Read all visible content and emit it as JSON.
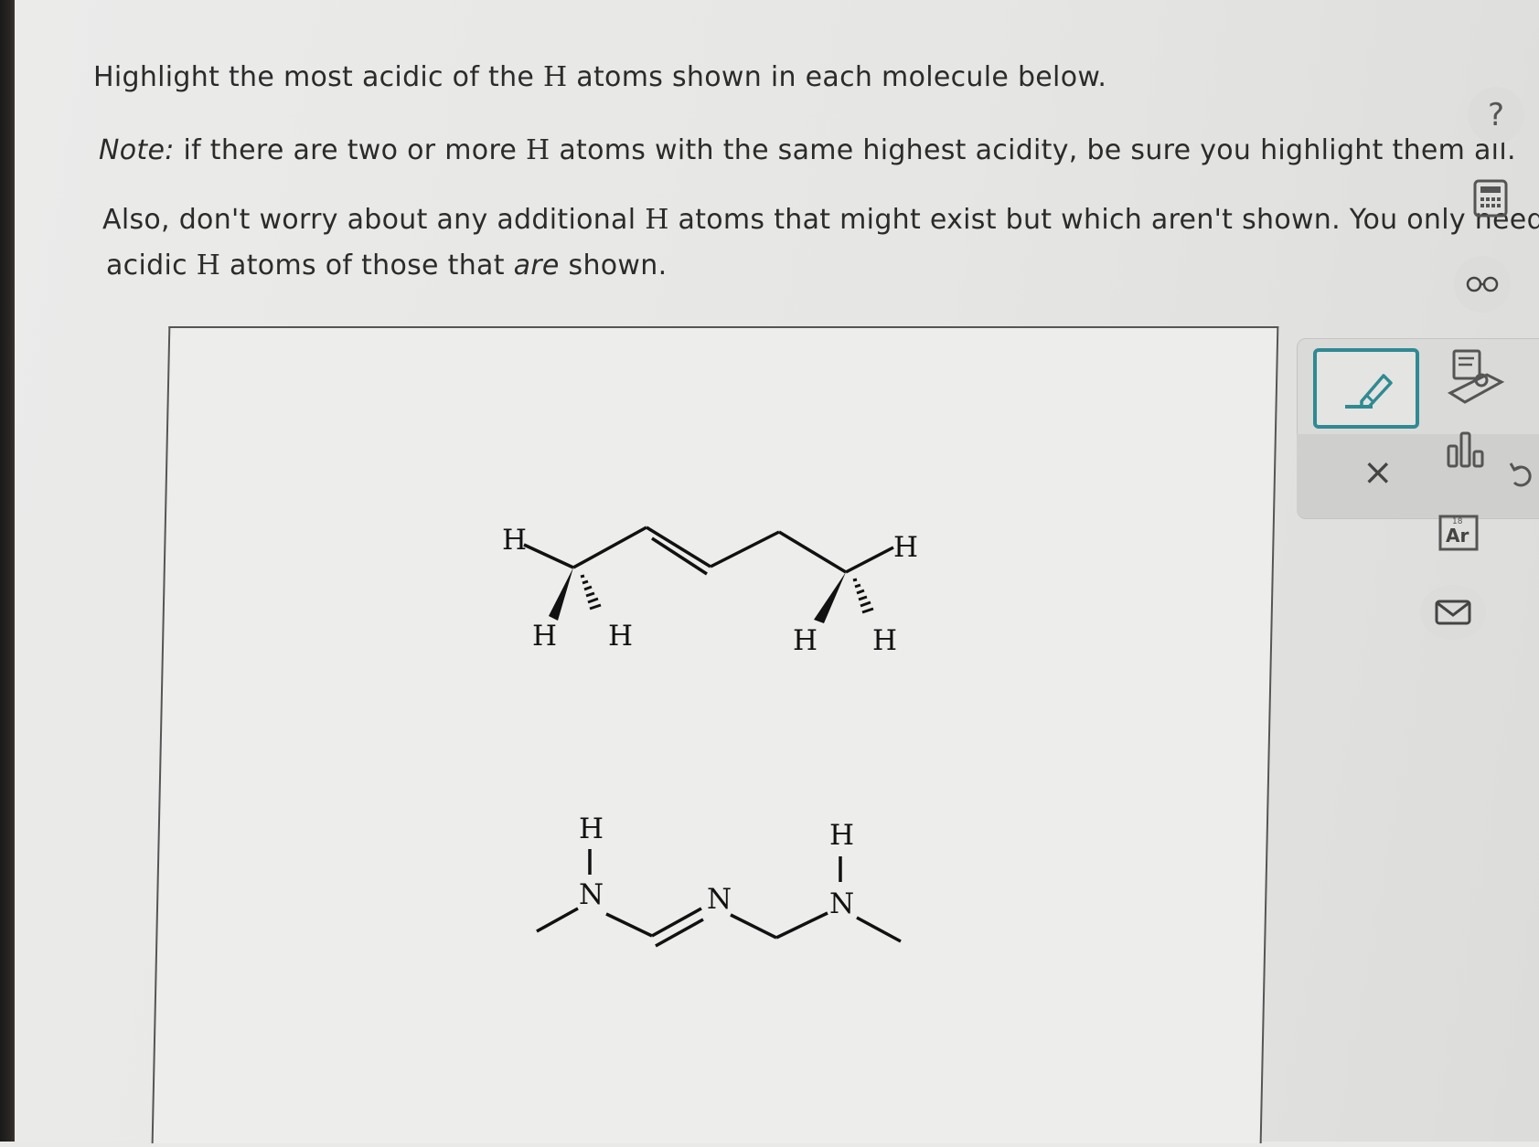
{
  "question": {
    "line1_pre": "Highlight the most acidic of the ",
    "h": "H",
    "line1_post": " atoms shown in each molecule below.",
    "note_label": "Note:",
    "line2_pre": " if there are two or more ",
    "line2_post": " atoms with the same highest acidity, be sure you highlight them all.",
    "line3_pre": "Also, don't worry about any additional ",
    "line3_post": " atoms that might exist but which aren't shown. You only need to fi",
    "line4_pre": "acidic ",
    "line4_mid": " atoms of those that ",
    "line4_em": "are",
    "line4_post": " shown."
  },
  "sidebar": {
    "help_symbol": "?",
    "glasses_symbol": "oo"
  },
  "molecule1": {
    "atoms": [
      "H",
      "H",
      "H",
      "H",
      "H",
      "H"
    ]
  },
  "molecule2": {
    "atoms": [
      "H",
      "N",
      "N",
      "H",
      "N"
    ]
  },
  "tools": {
    "clear_symbol": "×",
    "periodic_label": "Ar",
    "periodic_number": "18"
  },
  "colors": {
    "accent": "#2f8a93",
    "background": "#e9e9e7"
  }
}
